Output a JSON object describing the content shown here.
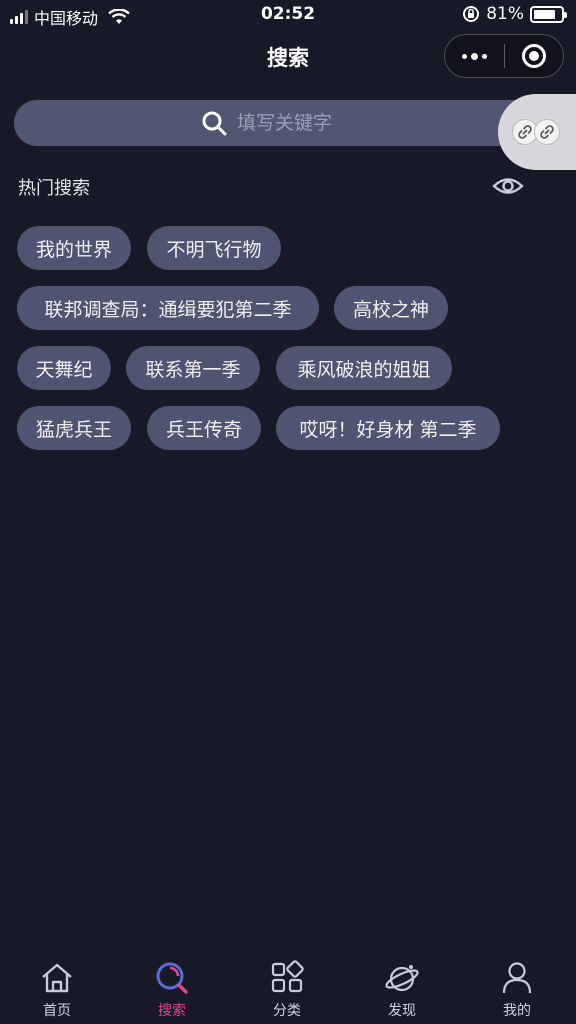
{
  "status_bar": {
    "carrier": "中国移动",
    "time": "02:52",
    "battery": "81%",
    "battery_level": 0.81
  },
  "nav": {
    "title": "搜索"
  },
  "search": {
    "placeholder": "填写关键字"
  },
  "hot": {
    "title": "热门搜索",
    "tags": [
      "我的世界",
      "不明飞行物",
      "联邦调查局：通缉要犯第二季",
      "高校之神",
      "天舞纪",
      "联系第一季",
      "乘风破浪的姐姐",
      "猛虎兵王",
      "兵王传奇",
      "哎呀！好身材 第二季"
    ]
  },
  "tabbar": {
    "items": [
      {
        "label": "首页",
        "icon": "home-icon"
      },
      {
        "label": "搜索",
        "icon": "search-icon"
      },
      {
        "label": "分类",
        "icon": "category-icon"
      },
      {
        "label": "发现",
        "icon": "discover-icon"
      },
      {
        "label": "我的",
        "icon": "user-icon"
      }
    ],
    "active_color": "#e04a8c"
  },
  "colors": {
    "background": "#171926",
    "tag_bg": "#4f5470",
    "search_bg": "#525771"
  }
}
